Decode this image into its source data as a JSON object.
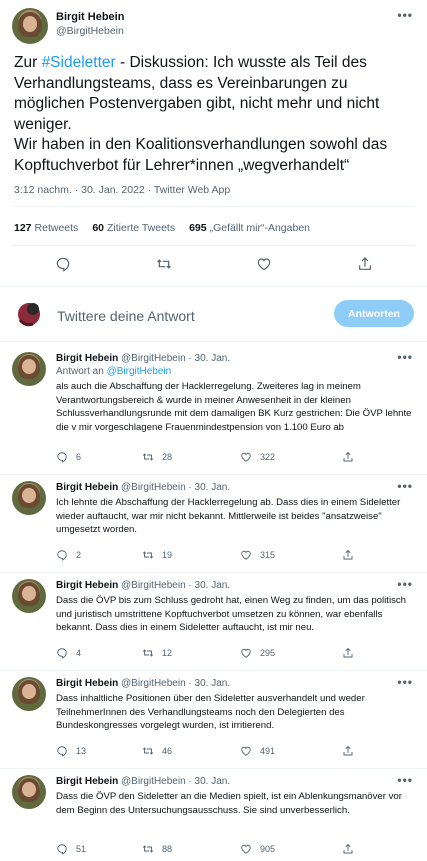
{
  "main_tweet": {
    "name": "Birgit Hebein",
    "handle": "@BirgitHebein",
    "text_prefix": "Zur ",
    "hashtag": "#Sideletter",
    "text_rest": " - Diskussion: Ich wusste als Teil des Verhandlungsteams, dass es Vereinbarungen zu möglichen Postenvergaben gibt, nicht mehr und nicht weniger.",
    "text_line2": "Wir haben in den Koalitionsverhandlungen sowohl das Kopftuchverbot für Lehrer*innen „wegverhandelt“",
    "meta": "3:12 nachm. · 30. Jan. 2022 · Twitter Web App",
    "stats": {
      "retweets_count": "127",
      "retweets_label": "Retweets",
      "quotes_count": "60",
      "quotes_label": "Zitierte Tweets",
      "likes_count": "695",
      "likes_label": "„Gefällt mir“-Angaben"
    }
  },
  "reply_box": {
    "prompt": "Twittere deine Antwort",
    "button_label": "Antworten"
  },
  "replies": [
    {
      "name": "Birgit Hebein",
      "handle": "@BirgitHebein",
      "sep": "·",
      "date": "30. Jan.",
      "replyto_label": "Antwort an ",
      "replyto_handle": "@BirgitHebein",
      "text": "als auch die Abschaffung der Hacklerregelung. Zweiteres lag in meinem Verantwortungsbereich & wurde in meiner Anwesenheit in der kleinen Schlussverhandlungsrunde mit dem damaligen BK Kurz gestrichen: Die ÖVP lehnte die v mir vorgeschlagene Frauenmindestpension von 1.100 Euro ab",
      "replies": "6",
      "retweets": "28",
      "likes": "322"
    },
    {
      "name": "Birgit Hebein",
      "handle": "@BirgitHebein",
      "sep": "·",
      "date": "30. Jan.",
      "text": "Ich lehnte die Abschaffung der Hacklerregelung ab. Dass dies in einem Sideletter wieder auftaucht, war mir nicht bekannt. Mittlerweile ist beides \"ansatzweise\" umgesetzt worden.",
      "replies": "2",
      "retweets": "19",
      "likes": "315"
    },
    {
      "name": "Birgit Hebein",
      "handle": "@BirgitHebein",
      "sep": "·",
      "date": "30. Jan.",
      "text": "Dass die ÖVP bis zum Schluss gedroht hat, einen Weg zu finden, um das politisch und juristisch umstrittene Kopftuchverbot umsetzen zu können, war ebenfalls bekannt. Dass dies in einem Sideletter auftaucht, ist mir neu.",
      "replies": "4",
      "retweets": "12",
      "likes": "295"
    },
    {
      "name": "Birgit Hebein",
      "handle": "@BirgitHebein",
      "sep": "·",
      "date": "30. Jan.",
      "text": "Dass inhaltliche Positionen über den Sideletter ausverhandelt und weder TeilnehmerInnen des Verhandlungsteams noch den Delegierten des Bundeskongresses vorgelegt wurden, ist irritierend.",
      "replies": "13",
      "retweets": "46",
      "likes": "491"
    },
    {
      "name": "Birgit Hebein",
      "handle": "@BirgitHebein",
      "sep": "·",
      "date": "30. Jan.",
      "text": "Dass die ÖVP den Sideletter an die Medien spielt, ist ein Ablenkungsmanöver vor dem Beginn des Untersuchungsausschuss. Sie sind unverbesserlich.",
      "replies": "51",
      "retweets": "88",
      "likes": "905"
    }
  ],
  "colors": {
    "accent": "#1d9bf0",
    "button_disabled": "#8ecdf8",
    "secondary_text": "#536471",
    "divider": "#eff3f4"
  },
  "icons": [
    "reply-icon",
    "retweet-icon",
    "like-icon",
    "share-icon",
    "more-icon"
  ]
}
